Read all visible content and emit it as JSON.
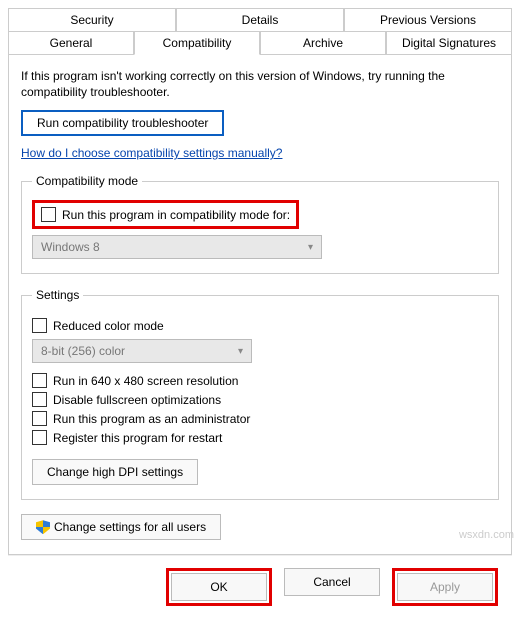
{
  "tabs": {
    "row1": [
      "Security",
      "Details",
      "Previous Versions"
    ],
    "row2": [
      "General",
      "Compatibility",
      "Archive",
      "Digital Signatures"
    ],
    "active": "Compatibility"
  },
  "intro": "If this program isn't working correctly on this version of Windows, try running the compatibility troubleshooter.",
  "troubleshoot_btn": "Run compatibility troubleshooter",
  "manual_link": "How do I choose compatibility settings manually?",
  "compat_mode": {
    "legend": "Compatibility mode",
    "checkbox": "Run this program in compatibility mode for:",
    "dropdown": "Windows 8"
  },
  "settings": {
    "legend": "Settings",
    "reduced_color": "Reduced color mode",
    "color_dropdown": "8-bit (256) color",
    "run_640": "Run in 640 x 480 screen resolution",
    "disable_fullscreen": "Disable fullscreen optimizations",
    "run_admin": "Run this program as an administrator",
    "register_restart": "Register this program for restart",
    "dpi_btn": "Change high DPI settings"
  },
  "all_users_btn": "Change settings for all users",
  "buttons": {
    "ok": "OK",
    "cancel": "Cancel",
    "apply": "Apply"
  },
  "watermark": "wsxdn.com"
}
